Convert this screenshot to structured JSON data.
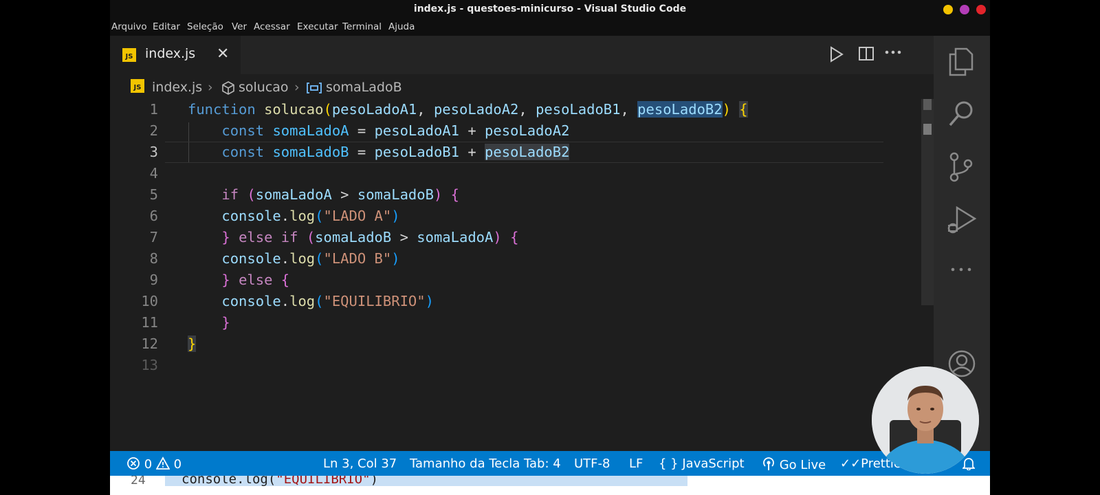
{
  "window": {
    "title": "index.js - questoes-minicurso - Visual Studio Code"
  },
  "menu": [
    "Arquivo",
    "Editar",
    "Seleção",
    "Ver",
    "Acessar",
    "Executar",
    "Terminal",
    "Ajuda"
  ],
  "tab": {
    "label": "index.js",
    "icon_text": "JS"
  },
  "breadcrumb": {
    "file": "index.js",
    "function": "solucao",
    "variable": "somaLadoB"
  },
  "editor": {
    "line_numbers": [
      "1",
      "2",
      "3",
      "4",
      "5",
      "6",
      "7",
      "8",
      "9",
      "10",
      "11",
      "12",
      "13"
    ],
    "active_line": 3
  },
  "status": {
    "errors": "0",
    "warnings": "0",
    "position": "Ln 3, Col 37",
    "tab_size": "Tamanho da Tecla Tab: 4",
    "encoding": "UTF-8",
    "eol": "LF",
    "language": "JavaScript",
    "golive": "Go Live",
    "prettier": "Prettie"
  },
  "bottom": {
    "line_number": "24",
    "code_prefix": "console.log(",
    "code_string": "\"EQUILIBRIO\"",
    "code_suffix": ")"
  },
  "colors": {
    "statusbar": "#007acc",
    "editor_bg": "#1e1e1e",
    "js_badge": "#f2c400"
  }
}
